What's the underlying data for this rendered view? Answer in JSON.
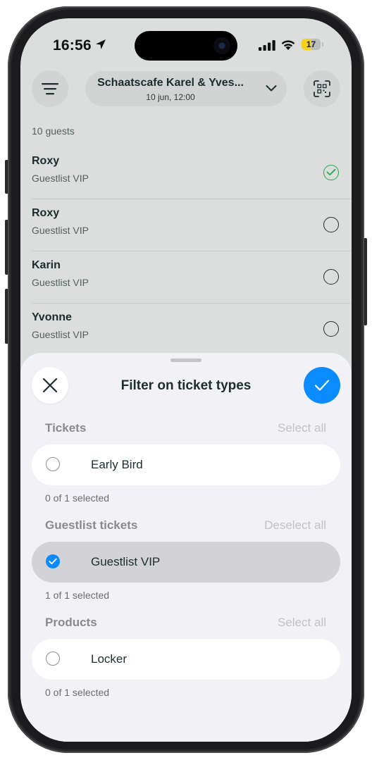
{
  "status_bar": {
    "time": "16:56",
    "battery": "17",
    "battery_level_percent": 17,
    "battery_color": "#f5d21b"
  },
  "header": {
    "filter_icon": "filter-lines-icon",
    "event_title": "Schaatscafe Karel & Yves...",
    "event_subtitle": "10 jun, 12:00",
    "event_chevron_icon": "chevron-down-icon",
    "scan_icon": "qr-scan-icon"
  },
  "guest_list": {
    "count_label": "10 guests",
    "guests": [
      {
        "name": "Roxy",
        "type": "Guestlist VIP",
        "checked_in": true
      },
      {
        "name": "Roxy",
        "type": "Guestlist VIP",
        "checked_in": false
      },
      {
        "name": "Karin",
        "type": "Guestlist VIP",
        "checked_in": false
      },
      {
        "name": "Yvonne",
        "type": "Guestlist VIP",
        "checked_in": false
      }
    ]
  },
  "sheet": {
    "title": "Filter on ticket types",
    "close_icon": "close-icon",
    "confirm_icon": "checkmark-icon",
    "accent_color": "#0a8cff",
    "sections": [
      {
        "heading": "Tickets",
        "action": "Select all",
        "options": [
          {
            "label": "Early Bird",
            "selected": false
          }
        ],
        "count": "0 of 1 selected"
      },
      {
        "heading": "Guestlist tickets",
        "action": "Deselect all",
        "options": [
          {
            "label": "Guestlist VIP",
            "selected": true
          }
        ],
        "count": "1 of 1 selected"
      },
      {
        "heading": "Products",
        "action": "Select all",
        "options": [
          {
            "label": "Locker",
            "selected": false
          }
        ],
        "count": "0 of 1 selected"
      }
    ]
  }
}
